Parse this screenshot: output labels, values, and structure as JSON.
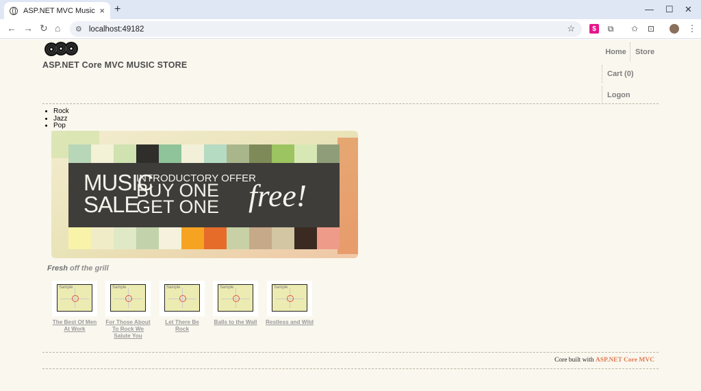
{
  "browser": {
    "tab_title": "ASP.NET MVC Music Store",
    "tab_close": "×",
    "new_tab": "+",
    "url": "localhost:49182",
    "window_controls": [
      "—",
      "☐",
      "✕"
    ],
    "extension_badge": "$"
  },
  "site": {
    "title": "ASP.NET Core MVC MUSIC STORE",
    "nav": {
      "home": "Home",
      "store": "Store",
      "cart": "Cart (0)",
      "logon": "Logon"
    }
  },
  "genres": [
    "Rock",
    "Jazz",
    "Pop"
  ],
  "banner": {
    "music": "MUSIC",
    "sale": "SALE",
    "intro": "INTRODUCTORY OFFER",
    "buy": "BUY ONE",
    "get": "GET ONE",
    "free": "free!"
  },
  "section": {
    "fresh": "Fresh",
    "rest": " off the grill"
  },
  "albums": [
    {
      "title": "The Best Of Men At Work",
      "art_label": "Sample"
    },
    {
      "title": "For Those About To Rock We Salute You",
      "art_label": "Sample"
    },
    {
      "title": "Let There Be Rock",
      "art_label": "Sample"
    },
    {
      "title": "Balls to the Wall",
      "art_label": "Sample"
    },
    {
      "title": "Restless and Wild",
      "art_label": "Sample"
    }
  ],
  "footer": {
    "prefix": "Core built with ",
    "link": "ASP.NET Core MVC"
  },
  "colors": {
    "page_bg": "#faf7ee",
    "accent_link": "#e07b53",
    "banner_dark": "#3e3d3a"
  }
}
